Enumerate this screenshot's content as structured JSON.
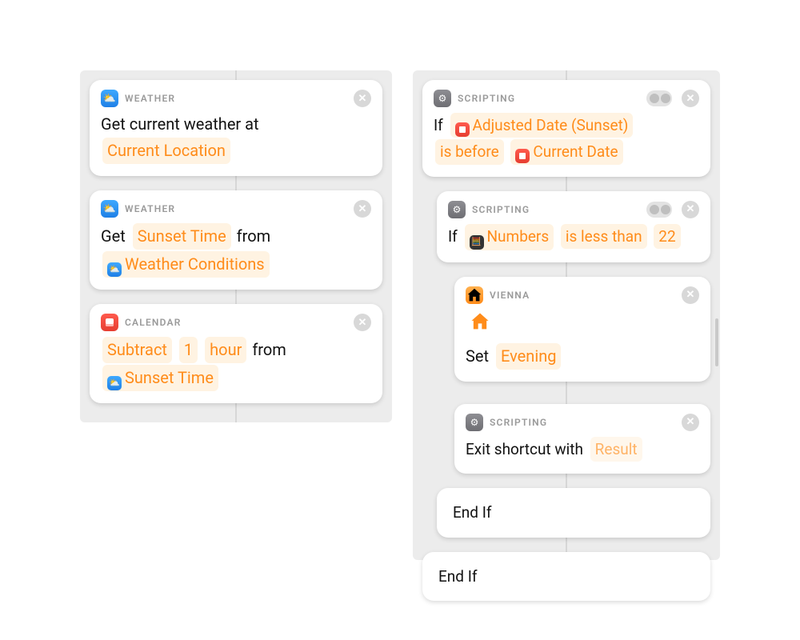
{
  "left": {
    "card1": {
      "app": "WEATHER",
      "text_pre": "Get current weather at",
      "token_location": "Current Location"
    },
    "card2": {
      "app": "WEATHER",
      "text_pre": "Get",
      "token_sunset": "Sunset Time",
      "text_mid": "from",
      "token_cond": "Weather Conditions"
    },
    "card3": {
      "app": "CALENDAR",
      "token_op": "Subtract",
      "token_n": "1",
      "token_unit": "hour",
      "text_mid": "from",
      "token_src": "Sunset Time"
    }
  },
  "right": {
    "if1": {
      "app": "SCRIPTING",
      "text_if": "If",
      "token_adj": "Adjusted Date (Sunset)",
      "token_rel": "is before",
      "token_cur": "Current Date"
    },
    "if2": {
      "app": "SCRIPTING",
      "text_if": "If",
      "token_num": "Numbers",
      "token_rel": "is less than",
      "token_val": "22"
    },
    "home": {
      "app": "VIENNA",
      "text_set": "Set",
      "token_scene": "Evening"
    },
    "exit": {
      "app": "SCRIPTING",
      "text_pre": "Exit shortcut with",
      "token_res": "Result"
    },
    "end1": "End If",
    "end2": "End If"
  }
}
